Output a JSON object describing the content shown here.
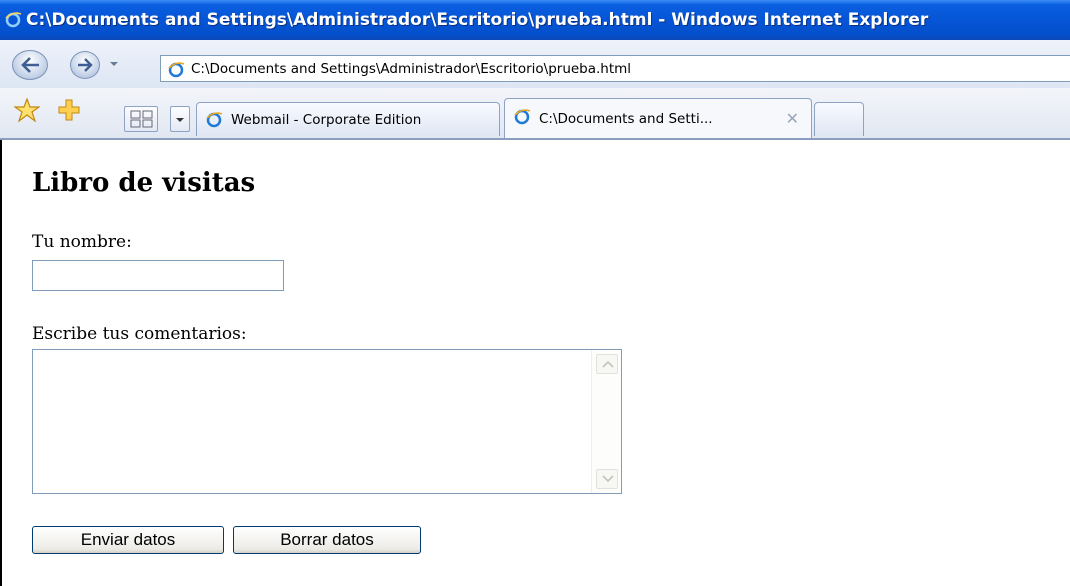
{
  "window": {
    "title": "C:\\Documents and Settings\\Administrador\\Escritorio\\prueba.html - Windows Internet Explorer"
  },
  "address_bar": {
    "url": "C:\\Documents and Settings\\Administrador\\Escritorio\\prueba.html"
  },
  "tabs": [
    {
      "label": "Webmail - Corporate Edition",
      "active": false
    },
    {
      "label": "C:\\Documents and Setti...",
      "active": true
    }
  ],
  "icons": {
    "favorites": "star-icon",
    "add_favorite": "plus-icon",
    "quick_tabs": "grid-icon",
    "browser": "ie-icon"
  },
  "page": {
    "title": "Libro de visitas",
    "name_label": "Tu nombre:",
    "name_value": "",
    "comments_label": "Escribe tus comentarios:",
    "comments_value": "",
    "submit_label": "Enviar datos",
    "reset_label": "Borrar datos"
  },
  "colors": {
    "titlebar": "#0655d6",
    "input_border": "#7f9db9",
    "button_border": "#003c74"
  }
}
